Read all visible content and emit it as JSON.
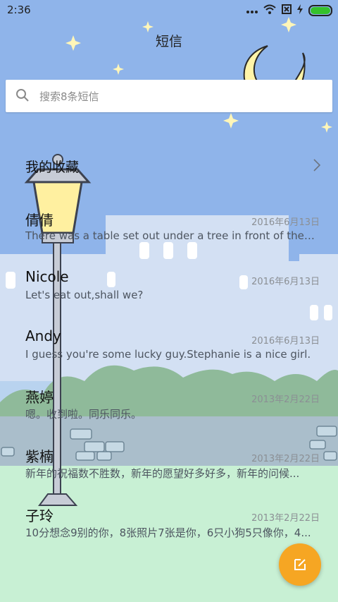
{
  "status_bar": {
    "time": "2:36",
    "icons": [
      "more-dots-icon",
      "wifi-icon",
      "no-sim-icon",
      "charging-icon",
      "battery-icon"
    ]
  },
  "header": {
    "title": "短信"
  },
  "search": {
    "placeholder": "搜索8条短信",
    "value": ""
  },
  "favorites": {
    "label": "我的收藏",
    "icon": "chevron-right-icon"
  },
  "messages": [
    {
      "name": "倩倩",
      "date": "2016年6月13日",
      "preview": "There was a table set out under a tree in front of the ho..."
    },
    {
      "name": "Nicole",
      "date": "2016年6月13日",
      "preview": "Let's eat out,shall we?"
    },
    {
      "name": "Andy",
      "date": "2016年6月13日",
      "preview": "I guess you're some lucky guy.Stephanie is a nice girl."
    },
    {
      "name": "燕婷",
      "date": "2013年2月22日",
      "preview": "嗯。收到啦。同乐同乐。"
    },
    {
      "name": "紫楠",
      "date": "2013年2月22日",
      "preview": "新年的祝福数不胜数，新年的愿望好多好多，新年的问候..."
    },
    {
      "name": "子玲",
      "date": "2013年2月22日",
      "preview": "10分想念9别的你，8张照片7张是你，6只小狗5只像你，4..."
    }
  ],
  "fab": {
    "icon": "compose-icon"
  },
  "colors": {
    "sky": "#8fb4ea",
    "grass": "#c8f0d4",
    "fab": "#f6a623",
    "text": "#111111",
    "date": "#8b8f94"
  }
}
